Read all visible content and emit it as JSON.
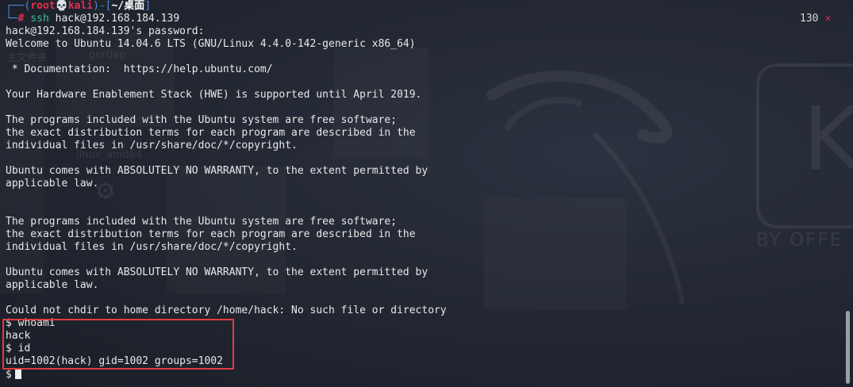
{
  "prompt": {
    "corner_top": "┌──(",
    "user": "root",
    "skull_icon": "💀",
    "host": "kali",
    "path_open": ")-[",
    "path": "~/桌面",
    "path_close": "]",
    "corner_bottom": "└─",
    "symbol": "#",
    "command": "ssh",
    "argument": "hack@192.168.184.139"
  },
  "status": {
    "exit_code": "130",
    "exit_icon": "✕"
  },
  "output": {
    "l1": "hack@192.168.184.139's password:",
    "l2": "Welcome to Ubuntu 14.04.6 LTS (GNU/Linux 4.4.0-142-generic x86_64)",
    "l3": "",
    "l4": " * Documentation:  https://help.ubuntu.com/",
    "l5": "",
    "l6": "Your Hardware Enablement Stack (HWE) is supported until April 2019.",
    "l7": "",
    "l8": "The programs included with the Ubuntu system are free software;",
    "l9": "the exact distribution terms for each program are described in the",
    "l10": "individual files in /usr/share/doc/*/copyright.",
    "l11": "",
    "l12": "Ubuntu comes with ABSOLUTELY NO WARRANTY, to the extent permitted by",
    "l13": "applicable law.",
    "l14": "",
    "l15": "",
    "l16": "The programs included with the Ubuntu system are free software;",
    "l17": "the exact distribution terms for each program are described in the",
    "l18": "individual files in /usr/share/doc/*/copyright.",
    "l19": "",
    "l20": "Ubuntu comes with ABSOLUTELY NO WARRANTY, to the extent permitted by",
    "l21": "applicable law.",
    "l22": "",
    "l23": "Could not chdir to home directory /home/hack: No such file or directory",
    "l24": "$ whoami",
    "l25": "hack",
    "l26": "$ id",
    "l27": "uid=1002(hack) gid=1002 groups=1002",
    "l28": "$"
  },
  "colors": {
    "highlight": "#e23b43",
    "prompt_red": "#e0314e",
    "prompt_blue": "#4f8ed6",
    "command_green": "#3fbf9d"
  }
}
